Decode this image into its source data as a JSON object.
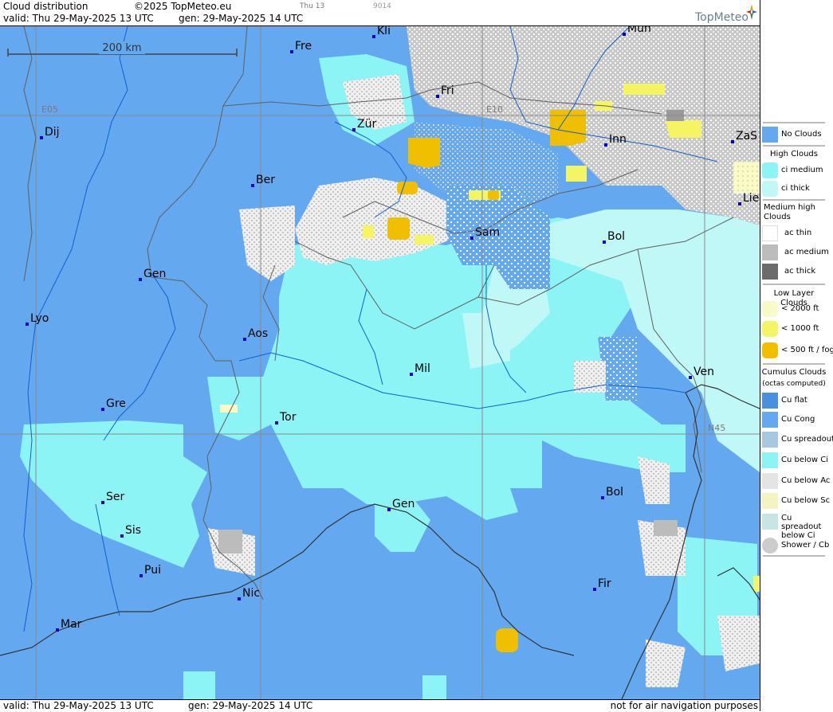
{
  "header": {
    "title": "Cloud distribution",
    "copyright": "©2025 TopMeteo.eu",
    "small1": "Thu 13",
    "small2": "9014",
    "valid": "valid:  Thu  29-May-2025  13 UTC",
    "gen": "gen: 29-May-2025 14 UTC",
    "brand": "TopMeteo"
  },
  "footer": {
    "valid": "valid:  Thu  29-May-2025  13 UTC",
    "gen": "gen: 29-May-2025 14 UTC",
    "note": "not for air navigation purposes"
  },
  "map": {
    "scale_label": "200 km",
    "grid_labels": [
      "E05",
      "E10",
      "N45"
    ],
    "cities": [
      "Kli",
      "Mun",
      "Fre",
      "Fri",
      "Dij",
      "Zür",
      "Inn",
      "ZaS",
      "Ber",
      "Lie",
      "Sam",
      "Bol",
      "Gen",
      "Lyo",
      "Aos",
      "Mil",
      "Ven",
      "Gre",
      "Tor",
      "Ser",
      "Gen",
      "Bol",
      "Sis",
      "Pui",
      "Nic",
      "Fir",
      "Mar"
    ]
  },
  "colors": {
    "no_clouds": "#64a8f0",
    "ci_medium": "#8cf4f4",
    "ci_thick": "#c0f8f8",
    "ac_thin": "#ffffff",
    "ac_medium": "#bcbcbc",
    "ac_thick": "#6c6c6c",
    "low_2000": "#fafac8",
    "low_1000": "#f4f464",
    "low_500": "#f0c000",
    "cu_flat": "#4a90e0",
    "city_marker": "#0000c0"
  },
  "legend": {
    "no_clouds": "No Clouds",
    "high_clouds": "High Clouds",
    "ci_medium": "ci medium",
    "ci_thick": "ci thick",
    "medium_high": "Medium high Clouds",
    "ac_thin": "ac thin",
    "ac_medium": "ac medium",
    "ac_thick": "ac thick",
    "low_layer": "Low Layer Clouds",
    "low_2000": "< 2000 ft",
    "low_1000": "< 1000 ft",
    "low_500": "< 500 ft / fog",
    "cumulus": "Cumulus Clouds",
    "octas": "(octas computed)",
    "cu_flat": "Cu flat",
    "cu_cong": "Cu Cong",
    "cu_spread": "Cu spreadout",
    "cu_below_ci": "Cu below Ci",
    "cu_below_ac": "Cu below Ac",
    "cu_below_sc": "Cu below Sc",
    "cu_spread_ci": "Cu spreadout below Ci",
    "shower": "Shower / Cb"
  }
}
